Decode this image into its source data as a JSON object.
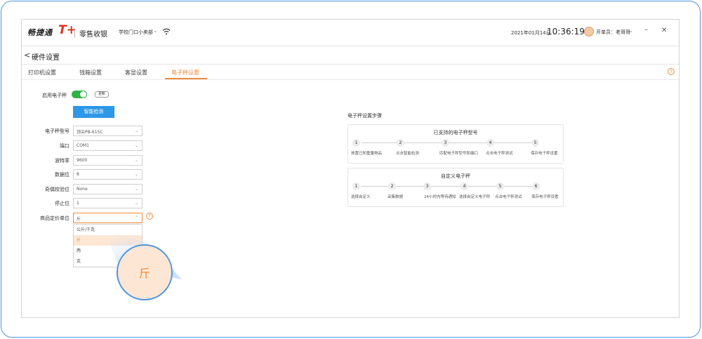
{
  "titlebar": {
    "brand": "畅捷通",
    "brand_mark": "T+",
    "product": "零售收银",
    "store": "学校门口小卖部",
    "date": "2021年01月14日",
    "time": "10:36:19",
    "cashier": "开单员：老哥哥",
    "min_glyph": "–",
    "close_glyph": "✕"
  },
  "page": {
    "back_glyph": "<",
    "title": "硬件设置"
  },
  "tabs": [
    "打印机设置",
    "钱箱设置",
    "客显设置",
    "电子秤设置"
  ],
  "active_tab": 3,
  "help_glyph": "?",
  "form": {
    "enable_label": "启用电子秤",
    "enabled": true,
    "update_label": "更新",
    "detect_button": "智能检测",
    "fields": [
      {
        "label": "电子秤型号",
        "value": "顶尖PB-615C"
      },
      {
        "label": "端口",
        "value": "COM1"
      },
      {
        "label": "波特率",
        "value": "9600"
      },
      {
        "label": "数据位",
        "value": "8"
      },
      {
        "label": "奇偶校验位",
        "value": "None"
      },
      {
        "label": "停止位",
        "value": "1"
      },
      {
        "label": "商品定价单位",
        "value": "斤"
      }
    ],
    "unit_options": [
      "公斤/千克",
      "斤",
      "两",
      "克"
    ],
    "unit_selected": "斤"
  },
  "callout": "斤",
  "steps": {
    "title": "电子秤设置步骤",
    "supported": {
      "title": "已支持的电子秤型号",
      "items": [
        "放置已知重量物品",
        "点击智能检测",
        "匹配电子秤型号和端口",
        "点击电子秤测试",
        "保存电子秤设置"
      ]
    },
    "custom": {
      "title": "自定义电子秤",
      "items": [
        "选择自定义",
        "采集数据",
        "24小时内等待通知",
        "选择自定义电子秤",
        "点击电子秤测试",
        "保存电子秤设置"
      ]
    }
  },
  "colors": {
    "accent": "#f08a3c",
    "primary": "#2d97e8",
    "toggle_on": "#2fb344",
    "frame": "#4f95e0"
  }
}
